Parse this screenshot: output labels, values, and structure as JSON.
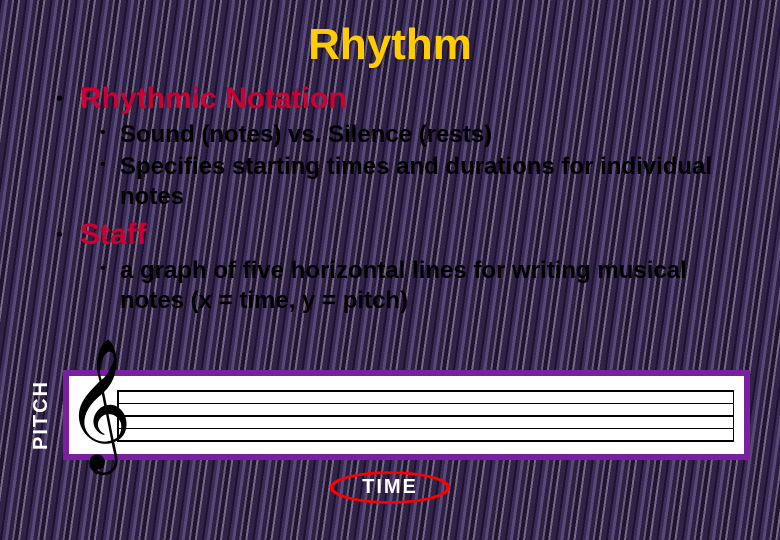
{
  "title": "Rhythm",
  "bullets": {
    "b1": {
      "head": "Rhythmic Notation",
      "sub1": "Sound (notes) vs. Silence (rests)",
      "sub2": "Specifies starting times and durations for individual notes"
    },
    "b2": {
      "head": "Staff",
      "sub1": "a graph of five horizontal lines for writing musical notes (x = time, y = pitch)"
    }
  },
  "axes": {
    "y": "PITCH",
    "x": "TIME"
  },
  "colors": {
    "title": "#ffcc00",
    "heading": "#cc0033",
    "frame": "#7a1fa2",
    "ellipse": "#ff0000"
  },
  "icons": {
    "clef": "𝄞"
  }
}
